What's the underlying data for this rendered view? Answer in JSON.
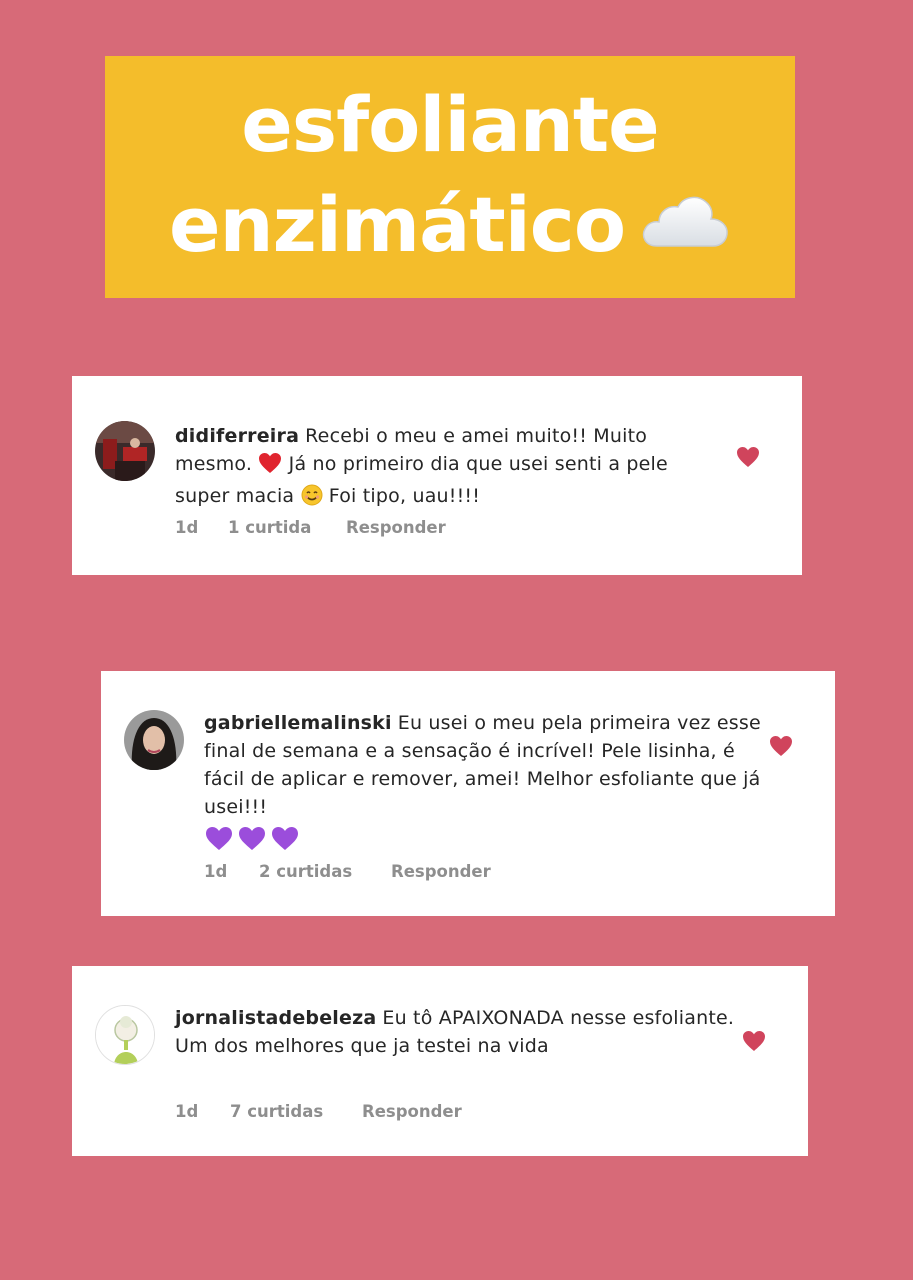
{
  "title": {
    "line1": "esfoliante",
    "line2": "enzimático"
  },
  "icons": {
    "title_decoration": "cloud-icon",
    "like": "heart-icon"
  },
  "colors": {
    "background": "#d76a78",
    "title_box": "#f4bd2b",
    "heart": "#d0445c",
    "meta_text": "#8e8e8e"
  },
  "comments": [
    {
      "username": "didiferreira",
      "text_parts": [
        "Recebi o meu e amei muito!! Muito mesmo.",
        "Já no primeiro dia que usei senti a pele super macia",
        "Foi tipo, uau!!!!"
      ],
      "age": "1d",
      "likes": "1 curtida",
      "reply": "Responder"
    },
    {
      "username": "gabriellemalinski",
      "text_parts": [
        "Eu usei o meu pela primeira vez esse final de semana e a sensação é incrível! Pele lisinha, é fácil de aplicar e remover, amei! Melhor esfoliante que já usei!!!"
      ],
      "age": "1d",
      "likes": "2 curtidas",
      "reply": "Responder"
    },
    {
      "username": "jornalistadebeleza",
      "text_parts": [
        "Eu tô APAIXONADA nesse esfoliante. Um dos melhores que ja testei na vida"
      ],
      "age": "1d",
      "likes": "7 curtidas",
      "reply": "Responder"
    }
  ]
}
